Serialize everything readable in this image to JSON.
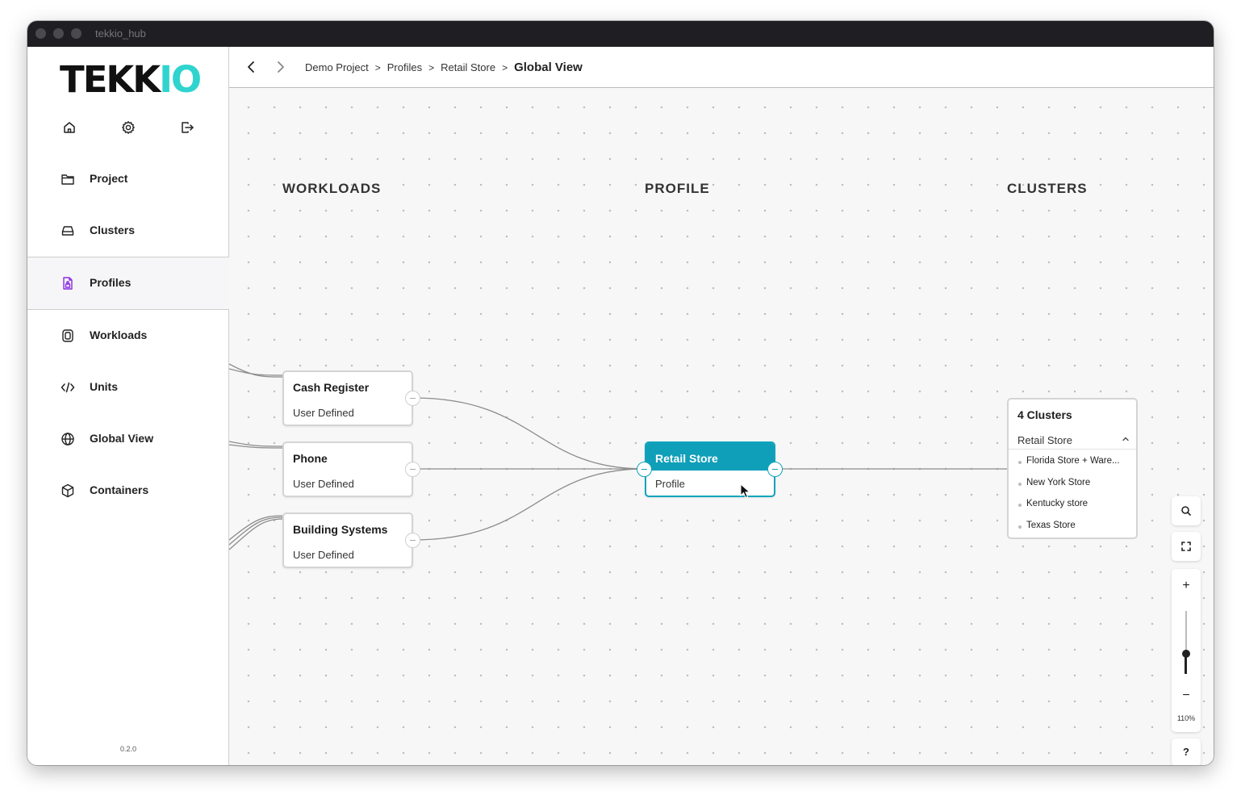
{
  "window": {
    "title": "tekkio_hub"
  },
  "logo": {
    "main": "TEKK",
    "accent": "IO",
    "accent_color": "#2fd4cf"
  },
  "sidebar": {
    "top_icons": [
      "home-icon",
      "gear-icon",
      "logout-icon"
    ],
    "items": [
      {
        "label": "Project",
        "icon": "folder-icon"
      },
      {
        "label": "Clusters",
        "icon": "drive-icon"
      },
      {
        "label": "Profiles",
        "icon": "profile-doc-icon",
        "active": true
      },
      {
        "label": "Workloads",
        "icon": "workloads-icon"
      },
      {
        "label": "Units",
        "icon": "code-icon"
      },
      {
        "label": "Global View",
        "icon": "globe-icon"
      },
      {
        "label": "Containers",
        "icon": "box-icon"
      }
    ],
    "version": "0.2.0"
  },
  "header": {
    "breadcrumbs": [
      "Demo Project",
      "Profiles",
      "Retail Store"
    ],
    "current": "Global View"
  },
  "canvas": {
    "columns": {
      "workloads": "WORKLOADS",
      "profile": "PROFILE",
      "clusters": "CLUSTERS"
    },
    "workloads": [
      {
        "title": "Cash Register",
        "subtitle": "User Defined"
      },
      {
        "title": "Phone",
        "subtitle": "User Defined"
      },
      {
        "title": "Building Systems",
        "subtitle": "User Defined"
      }
    ],
    "profile": {
      "title": "Retail Store",
      "subtitle": "Profile",
      "color": "#109fb8"
    },
    "clusters": {
      "title": "4 Clusters",
      "selected": "Retail Store",
      "items": [
        "Florida Store + Ware...",
        "New York Store",
        "Kentucky store",
        "Texas Store"
      ]
    },
    "controls": {
      "zoom_level": "110%",
      "help": "?",
      "zoom_in": "+",
      "zoom_out": "−"
    }
  }
}
